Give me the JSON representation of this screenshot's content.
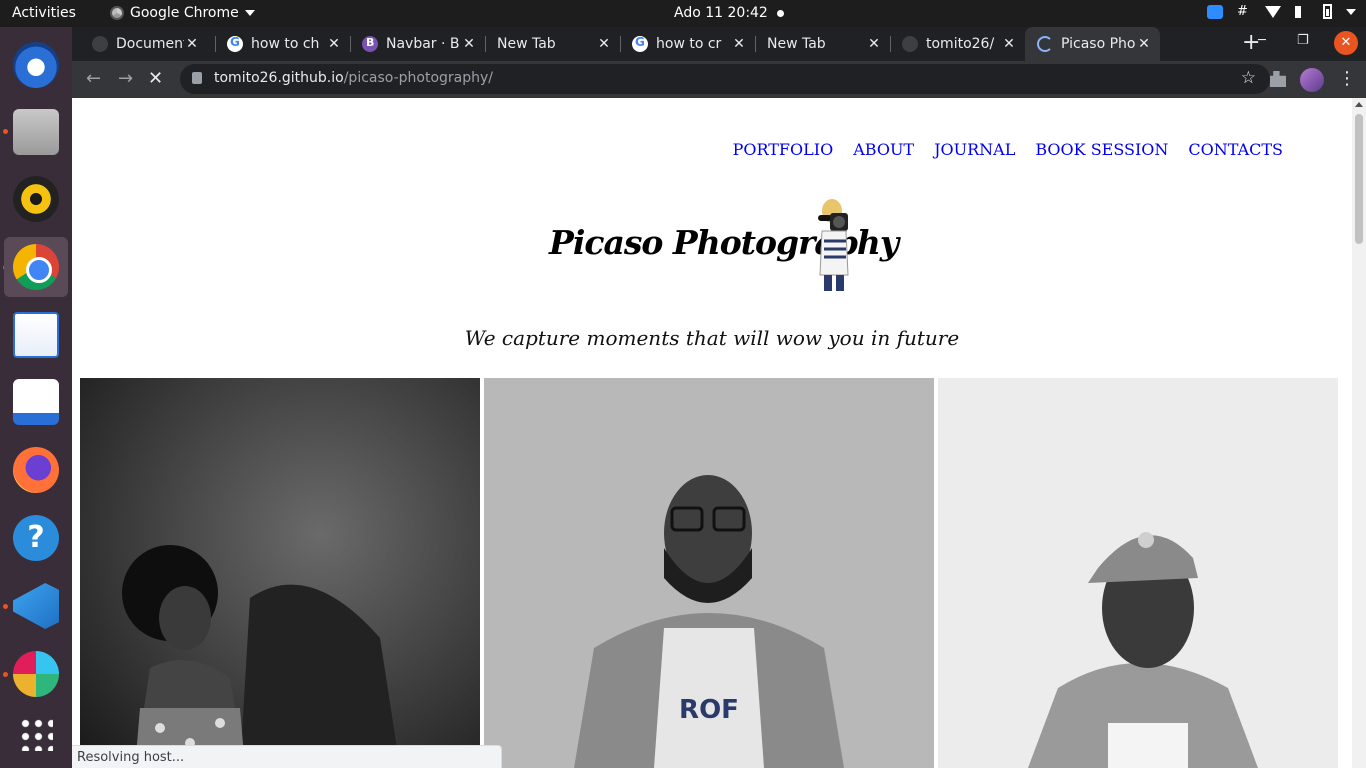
{
  "system": {
    "activities": "Activities",
    "app_menu": "Google Chrome",
    "clock": "Ado 11  20:42"
  },
  "dock": {
    "items": [
      "thunderbird-icon",
      "files-icon",
      "rhythmbox-icon",
      "chrome-icon",
      "libreoffice-impress-icon",
      "software-store-icon",
      "firefox-icon",
      "help-icon",
      "vscode-icon",
      "slack-icon",
      "show-apps-icon"
    ]
  },
  "browser": {
    "tabs": [
      {
        "title": "Document",
        "active": false
      },
      {
        "title": "how to ch",
        "active": false
      },
      {
        "title": "Navbar · B",
        "active": false
      },
      {
        "title": "New Tab",
        "active": false
      },
      {
        "title": "how to cr",
        "active": false
      },
      {
        "title": "New Tab",
        "active": false
      },
      {
        "title": "tomito26/",
        "active": false
      },
      {
        "title": "Picaso Pho",
        "active": true
      }
    ],
    "url_host": "tomito26.github.io",
    "url_path": "/picaso-photography/",
    "status": "Resolving host..."
  },
  "page": {
    "nav": [
      "PORTFOLIO",
      "ABOUT",
      "JOURNAL",
      "BOOK SESSION",
      "CONTACTS"
    ],
    "brand": "Picaso Photography",
    "tagline": "We capture moments that will wow you in future",
    "photos": [
      "portrait-woman-photo",
      "portrait-man-glasses-photo",
      "portrait-man-cap-photo"
    ]
  },
  "colors": {
    "link": "#0000ee",
    "chrome_dark": "#202124",
    "chrome_toolbar": "#35363a",
    "dock": "#3a2d3a",
    "accent": "#e95420"
  }
}
